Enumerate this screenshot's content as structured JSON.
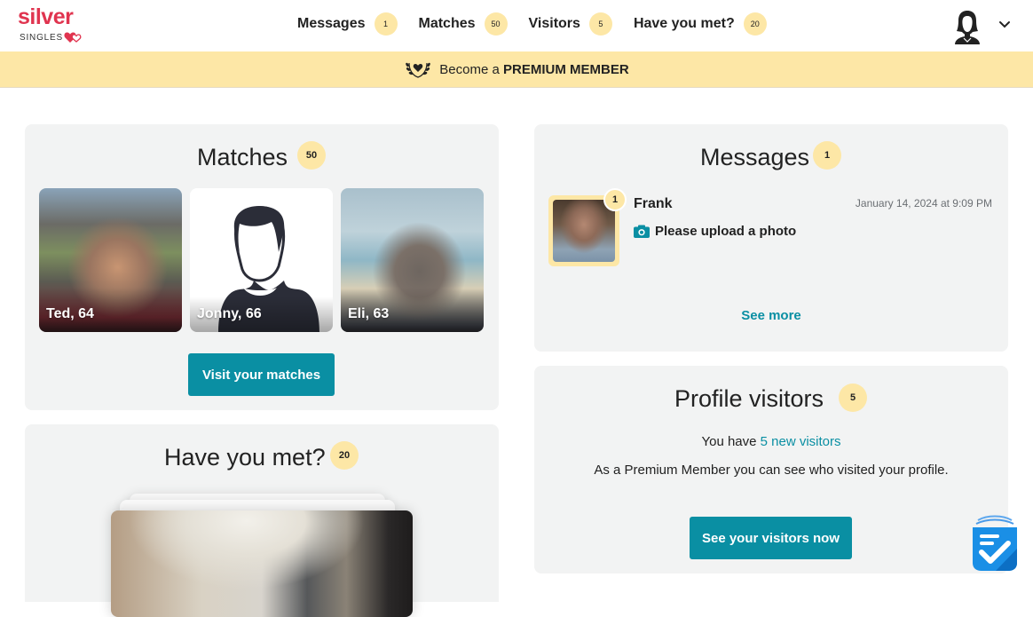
{
  "brand": {
    "name_top": "silver",
    "name_bottom": "SINGLES"
  },
  "nav": {
    "items": [
      {
        "label": "Messages",
        "count": "1"
      },
      {
        "label": "Matches",
        "count": "50"
      },
      {
        "label": "Visitors",
        "count": "5"
      },
      {
        "label": "Have you met?",
        "count": "20"
      }
    ]
  },
  "premium_banner": {
    "prefix": "Become a",
    "emphasis": "PREMIUM MEMBER"
  },
  "matches": {
    "title": "Matches",
    "count": "50",
    "profiles": [
      {
        "name": "Ted, 64"
      },
      {
        "name": "Jonny, 66"
      },
      {
        "name": "Eli, 63"
      }
    ],
    "button_label": "Visit your matches"
  },
  "have_you_met": {
    "title": "Have you met?",
    "count": "20"
  },
  "messages": {
    "title": "Messages",
    "count": "1",
    "items": [
      {
        "sender": "Frank",
        "unread": "1",
        "timestamp": "January 14, 2024 at 9:09 PM",
        "preview": "Please upload a photo"
      }
    ],
    "see_more_label": "See more"
  },
  "visitors": {
    "title": "Profile visitors",
    "count": "5",
    "line1_prefix": "You have",
    "line1_link": "5 new visitors",
    "line2": "As a Premium Member you can see who visited your profile.",
    "button_label": "See your visitors now"
  },
  "colors": {
    "brand_red": "#e0344f",
    "accent_teal": "#0a8fa3",
    "badge_yellow": "#fde7a6",
    "card_bg": "#f2f3f3"
  }
}
